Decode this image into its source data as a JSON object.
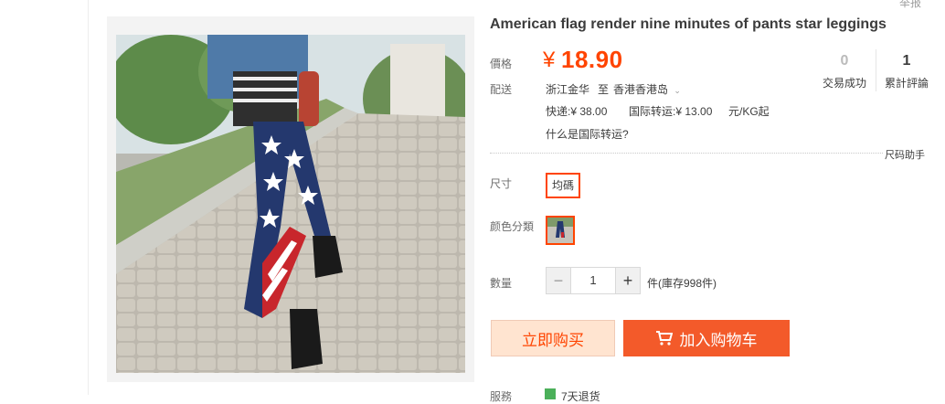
{
  "header": {
    "top_right_cut": "举报"
  },
  "product": {
    "title": "American flag render nine minutes of pants star leggings"
  },
  "price": {
    "label": "價格",
    "currency": "¥",
    "value": "18.90",
    "color": "#ff4400"
  },
  "stats": [
    {
      "value": "0",
      "label": "交易成功"
    },
    {
      "value": "1",
      "label": "累計評論"
    }
  ],
  "delivery": {
    "label": "配送",
    "from": "浙江金华",
    "to_word": "至",
    "destination": "香港香港岛",
    "express": "快递:¥ 38.00",
    "intl": "国际转运:¥ 13.00",
    "unit": "元/KG起",
    "intl_help": "什么是国际转运?"
  },
  "size_helper": "尺码助手",
  "size": {
    "label": "尺寸",
    "option": "均碼"
  },
  "color": {
    "label": "颜色分類",
    "thumbnail_icon": "leggings-thumbnail-icon"
  },
  "quantity": {
    "label": "數量",
    "minus": "−",
    "value": "1",
    "plus": "+",
    "stock": "件(庫存998件)"
  },
  "actions": {
    "buy_now": "立即购买",
    "add_to_cart": "加入购物车",
    "cart_icon": "cart-icon"
  },
  "service": {
    "label": "服務",
    "text": "7天退货"
  }
}
